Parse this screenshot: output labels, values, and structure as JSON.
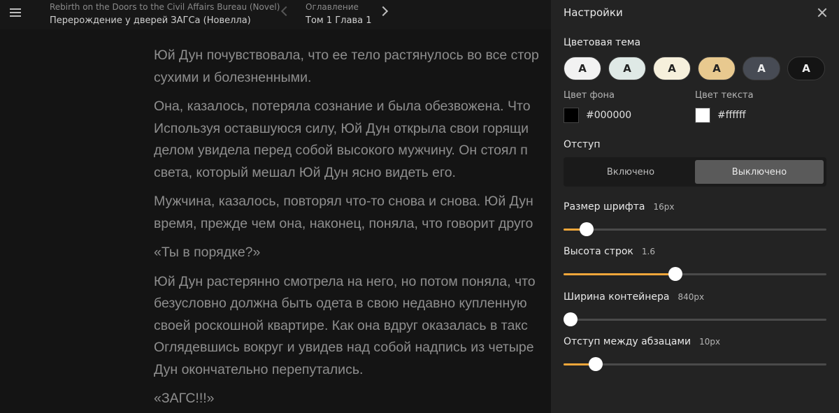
{
  "header": {
    "title_en": "Rebirth on the Doors to the Civil Affairs Bureau (Novel)",
    "title_ru": "Перерождение у дверей ЗАГСа (Новелла)",
    "toc_label": "Оглавление",
    "chapter": "Том 1 Глава 1"
  },
  "reader": {
    "paragraphs": [
      "Юй Дун почувствовала, что ее тело растянулось во все стор",
      "сухими и болезненными.",
      "Она, казалось, потеряла сознание и была обезвожена. Что",
      "Используя оставшуюся силу, Юй Дун открыла свои горящи",
      "делом увидела перед собой высокого мужчину. Он стоял п",
      "света, который мешал Юй Дун ясно видеть его.",
      "Мужчина, казалось, повторял что-то снова и снова. Юй Дун",
      "время, прежде чем она, наконец, поняла, что говорит друго",
      "«Ты в порядке?»",
      "Юй Дун растерянно смотрела на него, но потом поняла, что",
      "безусловно должна быть одета в свою недавно купленную",
      "своей роскошной квартире. Как она вдруг оказалась в такс",
      "Оглядевшись вокруг и увидев над собой надпись из четыре",
      "Дун окончательно перепутались.",
      "«ЗАГС!!!»"
    ]
  },
  "settings": {
    "title": "Настройки",
    "theme_label": "Цветовая тема",
    "themes": [
      {
        "letter": "A",
        "bg": "#f2f2f2",
        "fg": "#222222"
      },
      {
        "letter": "A",
        "bg": "#dfe9e6",
        "fg": "#222222"
      },
      {
        "letter": "A",
        "bg": "#f6f0dc",
        "fg": "#222222"
      },
      {
        "letter": "A",
        "bg": "#e8c98f",
        "fg": "#222222"
      },
      {
        "letter": "A",
        "bg": "#474b54",
        "fg": "#eeeeee"
      },
      {
        "letter": "A",
        "bg": "#141414",
        "fg": "#eeeeee"
      }
    ],
    "bg_color_label": "Цвет фона",
    "bg_color_value": "#000000",
    "text_color_label": "Цвет текста",
    "text_color_value": "#ffffff",
    "indent_label": "Отступ",
    "indent_on": "Включено",
    "indent_off": "Выключено",
    "indent_selected": "off",
    "sliders": [
      {
        "name": "Размер шрифта",
        "value": "16px",
        "fraction": 0.088
      },
      {
        "name": "Высота строк",
        "value": "1.6",
        "fraction": 0.426
      },
      {
        "name": "Ширина контейнера",
        "value": "840px",
        "fraction": 0.0
      },
      {
        "name": "Отступ между абзацами",
        "value": "10px",
        "fraction": 0.122
      }
    ],
    "accent_color": "#f0a63a"
  }
}
